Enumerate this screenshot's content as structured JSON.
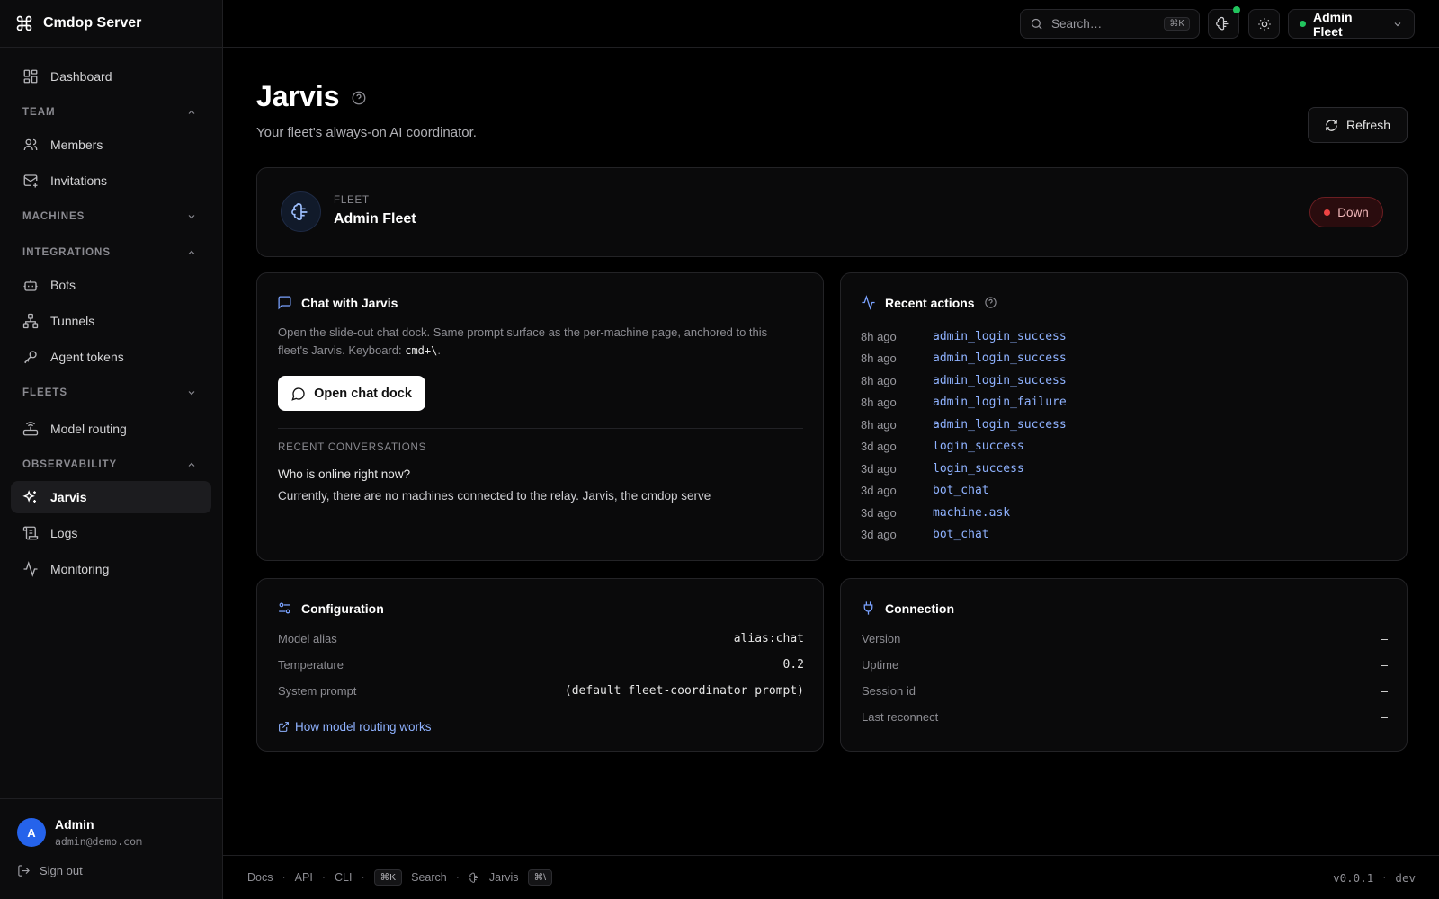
{
  "app": {
    "name": "Cmdop Server"
  },
  "sidebar": {
    "dashboard": "Dashboard",
    "sections": {
      "team": "TEAM",
      "machines": "MACHINES",
      "integrations": "INTEGRATIONS",
      "fleets": "FLEETS",
      "observability": "OBSERVABILITY"
    },
    "items": {
      "members": "Members",
      "invitations": "Invitations",
      "bots": "Bots",
      "tunnels": "Tunnels",
      "agent_tokens": "Agent tokens",
      "model_routing": "Model routing",
      "jarvis": "Jarvis",
      "logs": "Logs",
      "monitoring": "Monitoring"
    },
    "user": {
      "initial": "A",
      "name": "Admin",
      "email": "admin@demo.com"
    },
    "sign_out": "Sign out"
  },
  "topbar": {
    "search_placeholder": "Search…",
    "search_shortcut": "⌘K",
    "fleet_selector": "Admin Fleet"
  },
  "page": {
    "title": "Jarvis",
    "subtitle": "Your fleet's always-on AI coordinator.",
    "refresh_label": "Refresh"
  },
  "fleet": {
    "label": "FLEET",
    "name": "Admin Fleet",
    "status": "Down"
  },
  "chat": {
    "title": "Chat with Jarvis",
    "description_1": "Open the slide-out chat dock. Same prompt surface as the per-machine page, anchored to this fleet's Jarvis. Keyboard: ",
    "shortcut": "cmd+\\",
    "description_2": ".",
    "open_button": "Open chat dock",
    "recent_label": "RECENT CONVERSATIONS",
    "recent_question": "Who is online right now?",
    "recent_answer": "Currently, there are no machines connected to the relay. Jarvis, the cmdop serve"
  },
  "recent_actions": {
    "title": "Recent actions",
    "items": [
      {
        "time": "8h ago",
        "name": "admin_login_success"
      },
      {
        "time": "8h ago",
        "name": "admin_login_success"
      },
      {
        "time": "8h ago",
        "name": "admin_login_success"
      },
      {
        "time": "8h ago",
        "name": "admin_login_failure"
      },
      {
        "time": "8h ago",
        "name": "admin_login_success"
      },
      {
        "time": "3d ago",
        "name": "login_success"
      },
      {
        "time": "3d ago",
        "name": "login_success"
      },
      {
        "time": "3d ago",
        "name": "bot_chat"
      },
      {
        "time": "3d ago",
        "name": "machine.ask"
      },
      {
        "time": "3d ago",
        "name": "bot_chat"
      }
    ]
  },
  "configuration": {
    "title": "Configuration",
    "model_alias_label": "Model alias",
    "model_alias_value": "alias:chat",
    "temperature_label": "Temperature",
    "temperature_value": "0.2",
    "system_prompt_label": "System prompt",
    "system_prompt_value": "(default fleet-coordinator prompt)",
    "link": "How model routing works"
  },
  "connection": {
    "title": "Connection",
    "version_label": "Version",
    "version_value": "–",
    "uptime_label": "Uptime",
    "uptime_value": "–",
    "session_label": "Session id",
    "session_value": "–",
    "reconnect_label": "Last reconnect",
    "reconnect_value": "–"
  },
  "footer": {
    "docs": "Docs",
    "api": "API",
    "cli": "CLI",
    "search_kbd": "⌘K",
    "search": "Search",
    "jarvis": "Jarvis",
    "jarvis_kbd": "⌘\\",
    "version": "v0.0.1",
    "env": "dev"
  },
  "colors": {
    "accent": "#8fb2ff",
    "status_down": "#ef4444",
    "online": "#22c55e",
    "avatar": "#2563eb"
  }
}
